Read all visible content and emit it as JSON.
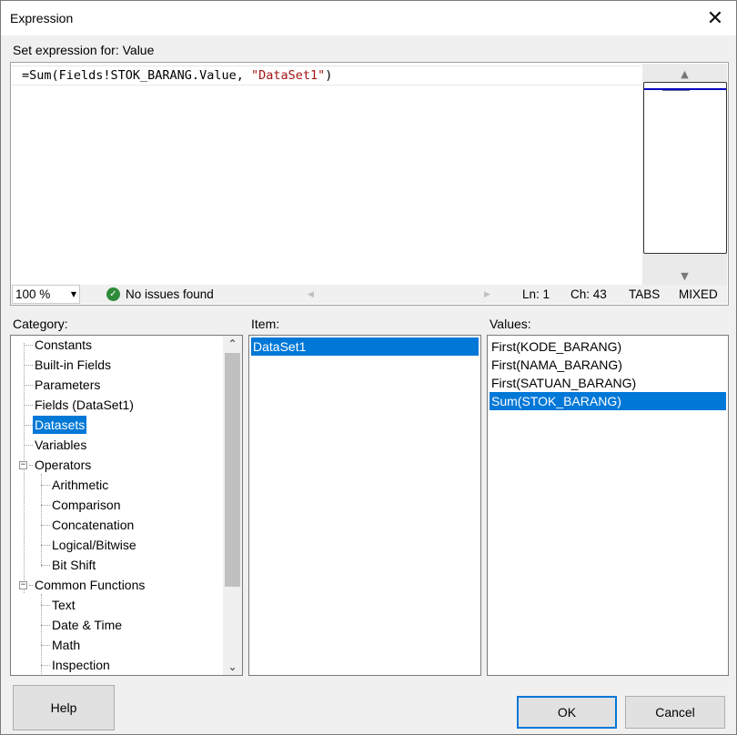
{
  "window": {
    "title": "Expression",
    "close_glyph": "✕"
  },
  "expression": {
    "label": "Set expression for: Value",
    "code_prefix": "=Sum(Fields!STOK_BARANG.Value, ",
    "code_string": "\"DataSet1\"",
    "code_suffix": ")"
  },
  "status": {
    "zoom": "100 %",
    "issues": "No issues found",
    "line": "Ln: 1",
    "column": "Ch: 43",
    "tabs": "TABS",
    "mixed": "MIXED"
  },
  "category": {
    "label": "Category:",
    "items": [
      {
        "label": "Constants"
      },
      {
        "label": "Built-in Fields"
      },
      {
        "label": "Parameters"
      },
      {
        "label": "Fields (DataSet1)"
      },
      {
        "label": "Datasets"
      },
      {
        "label": "Variables"
      },
      {
        "label": "Operators"
      },
      {
        "label": "Arithmetic"
      },
      {
        "label": "Comparison"
      },
      {
        "label": "Concatenation"
      },
      {
        "label": "Logical/Bitwise"
      },
      {
        "label": "Bit Shift"
      },
      {
        "label": "Common Functions"
      },
      {
        "label": "Text"
      },
      {
        "label": "Date & Time"
      },
      {
        "label": "Math"
      },
      {
        "label": "Inspection"
      }
    ],
    "selected": "Datasets"
  },
  "item": {
    "label": "Item:",
    "items": [
      {
        "label": "DataSet1"
      }
    ],
    "selected": "DataSet1"
  },
  "values": {
    "label": "Values:",
    "items": [
      {
        "label": "First(KODE_BARANG)"
      },
      {
        "label": "First(NAMA_BARANG)"
      },
      {
        "label": "First(SATUAN_BARANG)"
      },
      {
        "label": "Sum(STOK_BARANG)"
      }
    ],
    "selected": "Sum(STOK_BARANG)"
  },
  "buttons": {
    "help": "Help",
    "ok": "OK",
    "cancel": "Cancel"
  },
  "colors": {
    "selection": "#0078d7",
    "string_literal": "#a31515",
    "success": "#2e8b3a"
  }
}
